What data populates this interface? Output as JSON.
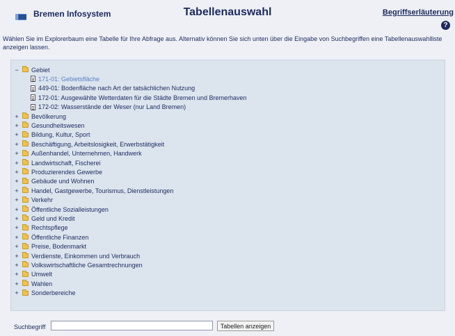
{
  "header": {
    "app_name": "Bremen Infosystem",
    "page_title": "Tabellenauswahl",
    "glossary_link": "Begriffserläuterung",
    "help_label": "?"
  },
  "intro": "Wählen Sie im Explorerbaum eine Tabelle für Ihre Abfrage aus. Alternativ können Sie sich unten über die Eingabe von Suchbegriffen eine Tabellenauswahlliste anzeigen lassen.",
  "tree": {
    "expanded_folder": {
      "label": "Gebiet",
      "expander": "−",
      "tables": [
        {
          "label": "171-01: Gebietsfläche",
          "selected": true
        },
        {
          "label": "449-01: Bodenfläche nach Art der tatsächlichen Nutzung",
          "selected": false
        },
        {
          "label": "172-01: Ausgewählte Wetterdaten für die Städte Bremen und Bremerhaven",
          "selected": false
        },
        {
          "label": "172-02: Wasserstände der Weser (nur Land Bremen)",
          "selected": false
        }
      ]
    },
    "collapsed_expander": "+",
    "folders": [
      "Bevölkerung",
      "Gesundheitswesen",
      "Bildung, Kultur, Sport",
      "Beschäftigung, Arbeitslosigkeit, Erwerbstätigkeit",
      "Außenhandel, Unternehmen, Handwerk",
      "Landwirtschaft, Fischerei",
      "Produzierendes Gewerbe",
      "Gebäude und Wohnen",
      "Handel, Gastgewerbe, Tourismus, Dienstleistungen",
      "Verkehr",
      "Öffentliche Sozialleistungen",
      "Geld und Kredit",
      "Rechtspflege",
      "Öffentliche Finanzen",
      "Preise, Bodenmarkt",
      "Verdienste, Einkommen und Verbrauch",
      "Volkswirtschaftliche Gesamtrechnungen",
      "Umwelt",
      "Wahlen",
      "Sonderbereiche"
    ]
  },
  "search": {
    "label": "Suchbegriff",
    "value": "",
    "placeholder": "",
    "button_label": "Tabellen anzeigen"
  }
}
